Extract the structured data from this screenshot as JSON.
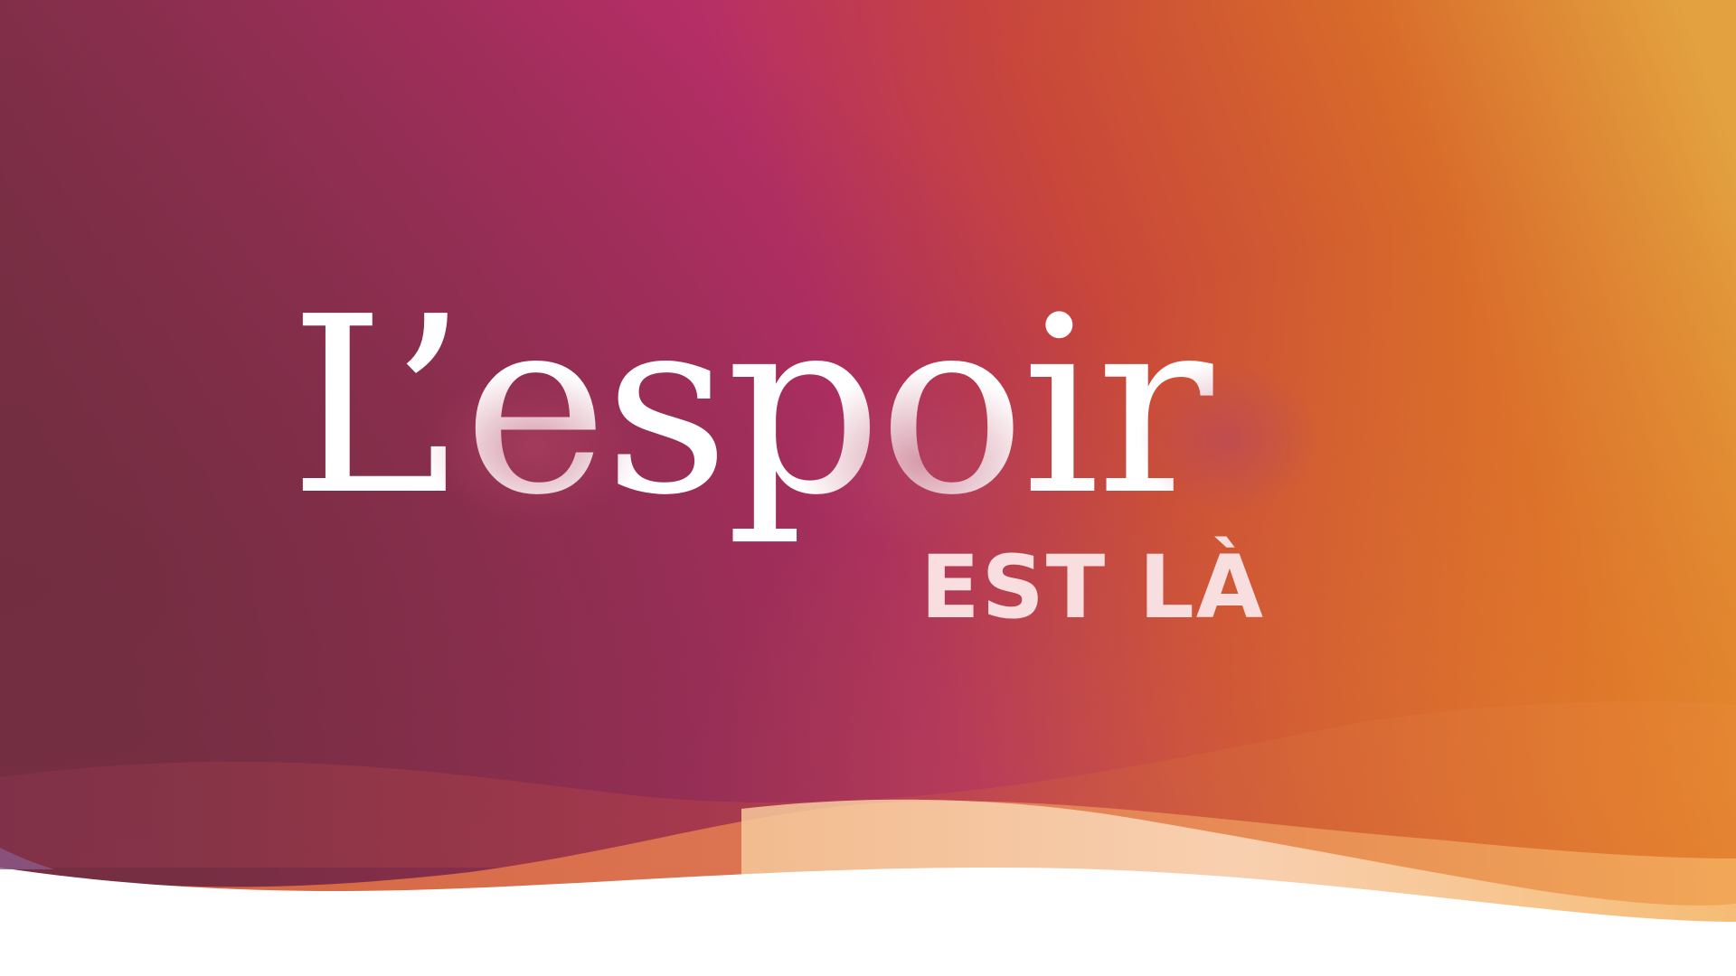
{
  "banner": {
    "headline": "L’espoir",
    "subline": "EST LÀ"
  },
  "colors": {
    "gradient_stops": [
      "#7a2f45",
      "#b52e66",
      "#c8473a",
      "#d86a2a",
      "#e3a23f"
    ],
    "headline_text": "#ffffff",
    "subline_text": "#f8dedf",
    "wave_primary": "#e8834a",
    "wave_light": "#f9d9b6",
    "page_background": "#ffffff"
  }
}
